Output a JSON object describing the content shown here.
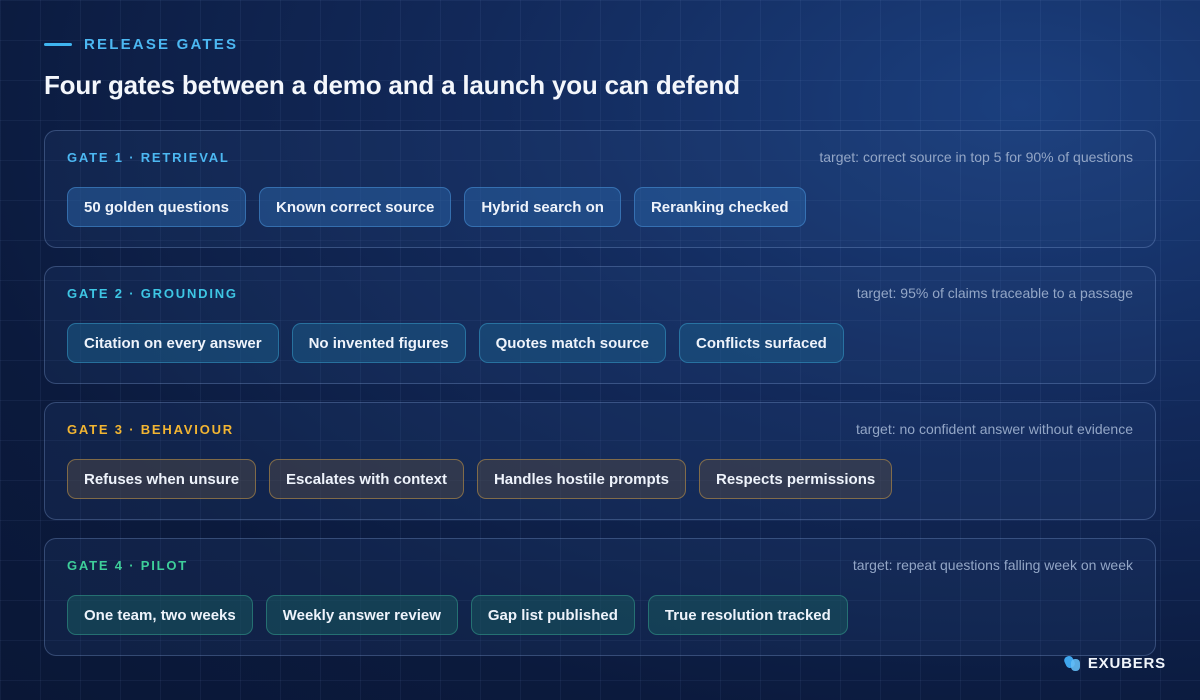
{
  "eyebrow": "RELEASE GATES",
  "title": "Four gates between a demo and a launch you can defend",
  "gates": [
    {
      "label": "GATE 1  ·  RETRIEVAL",
      "target": "target: correct source in top 5 for 90% of questions",
      "color": "#4cb8f2",
      "chips": [
        "50 golden questions",
        "Known correct source",
        "Hybrid search on",
        "Reranking checked"
      ]
    },
    {
      "label": "GATE 2  ·  GROUNDING",
      "target": "target: 95% of claims traceable to a passage",
      "color": "#3ec6e4",
      "chips": [
        "Citation on every answer",
        "No invented figures",
        "Quotes match source",
        "Conflicts surfaced"
      ]
    },
    {
      "label": "GATE 3  ·  BEHAVIOUR",
      "target": "target: no confident answer without evidence",
      "color": "#f2b532",
      "chips": [
        "Refuses when unsure",
        "Escalates with context",
        "Handles hostile prompts",
        "Respects permissions"
      ]
    },
    {
      "label": "GATE 4  ·  PILOT",
      "target": "target: repeat questions falling week on week",
      "color": "#3ecf9a",
      "chips": [
        "One team, two weeks",
        "Weekly answer review",
        "Gap list published",
        "True resolution tracked"
      ]
    }
  ],
  "brand": {
    "name": "EXUBERS",
    "icon": "exubers-logo-icon",
    "color": "#3fa6ee"
  }
}
